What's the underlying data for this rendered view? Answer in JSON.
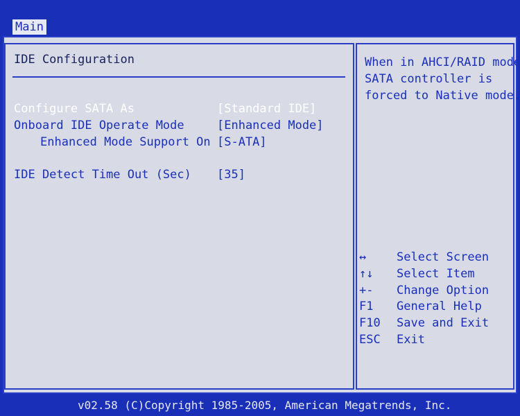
{
  "menu": {
    "tabs": [
      {
        "label": "Main"
      }
    ]
  },
  "panel": {
    "title": "IDE Configuration",
    "settings": [
      {
        "label": "Configure SATA As",
        "value": "[Standard IDE]",
        "selected": true
      },
      {
        "label": "Onboard IDE Operate Mode",
        "value": "[Enhanced Mode]",
        "selected": false
      },
      {
        "label": "Enhanced Mode Support On",
        "value": "[S-ATA]",
        "selected": false
      },
      {
        "label": "IDE Detect Time Out (Sec)",
        "value": "[35]",
        "selected": false
      }
    ]
  },
  "help": {
    "lines": [
      "When in AHCI/RAID mode",
      "SATA controller is",
      "forced to Native mode."
    ]
  },
  "keys": [
    {
      "key": "↔",
      "desc": "Select Screen"
    },
    {
      "key": "↑↓",
      "desc": "Select Item"
    },
    {
      "key": "+-",
      "desc": "Change Option"
    },
    {
      "key": "F1",
      "desc": "General Help"
    },
    {
      "key": "F10",
      "desc": "Save and Exit"
    },
    {
      "key": "ESC",
      "desc": "Exit"
    }
  ],
  "footer": {
    "copyright": "v02.58 (C)Copyright 1985-2005, American Megatrends, Inc."
  },
  "colors": {
    "background": "#1a2fb8",
    "panel": "#d8dbe6",
    "text": "#1a2fb8",
    "selected_text": "#ffffff"
  }
}
